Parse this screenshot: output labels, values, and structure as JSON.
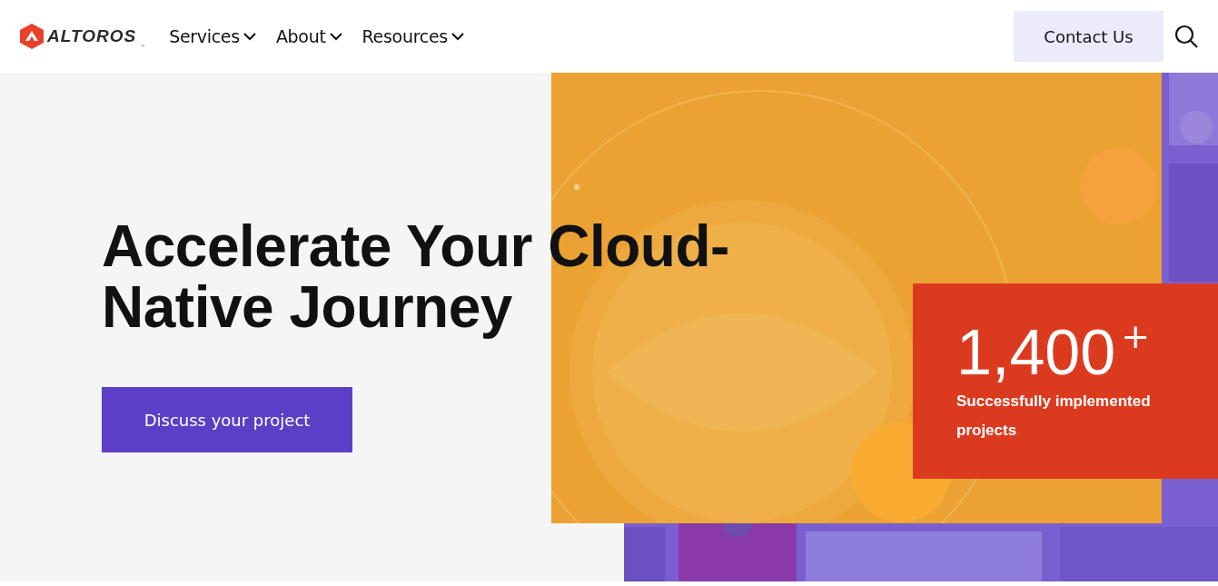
{
  "header": {
    "logo": {
      "text": "ALTOROS",
      "mark": "™"
    },
    "nav": [
      {
        "label": "Services"
      },
      {
        "label": "About"
      },
      {
        "label": "Resources"
      }
    ],
    "contact_button": "Contact Us"
  },
  "hero": {
    "title_lines": [
      "Accelerate Your Cloud-",
      "Native Journey"
    ],
    "cta": "Discuss your project",
    "stat": {
      "value": "1,400",
      "suffix": "+",
      "caption": "Successfully implemented projects"
    }
  }
}
